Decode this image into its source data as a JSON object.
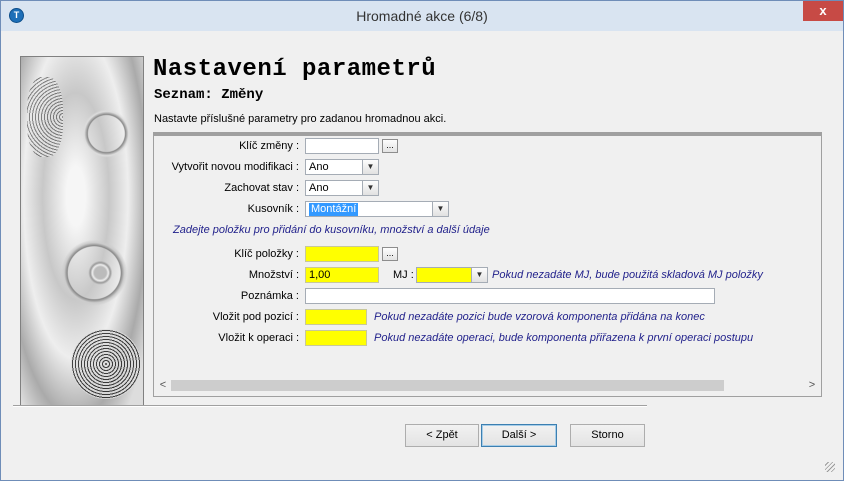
{
  "window": {
    "title": "Hromadné akce (6/8)",
    "close_glyph": "x",
    "app_icon_glyph": "T"
  },
  "header": {
    "title": "Nastavení parametrů",
    "subtitle": "Seznam: Změny",
    "description": "Nastavte příslušné parametry pro zadanou hromadnou akci."
  },
  "form": {
    "klic_zmeny": {
      "label": "Klíč změny :",
      "value": "",
      "browse_label": "..."
    },
    "vytvorit_modifikaci": {
      "label": "Vytvořit novou modifikaci :",
      "value": "Ano"
    },
    "zachovat_stav": {
      "label": "Zachovat stav :",
      "value": "Ano"
    },
    "kusovnik": {
      "label": "Kusovník :",
      "value": "Montážní"
    },
    "section_hint": "Zadejte položku pro přidání do kusovníku, množství a další údaje",
    "klic_polozky": {
      "label": "Klíč položky :",
      "value": "",
      "browse_label": "..."
    },
    "mnozstvi": {
      "label": "Množství :",
      "value": "1,00"
    },
    "mj": {
      "label": "MJ :",
      "value": "",
      "hint": "Pokud nezadáte MJ, bude použitá skladová MJ položky"
    },
    "poznamka": {
      "label": "Poznámka :",
      "value": ""
    },
    "vlozit_pod_pozici": {
      "label": "Vložit pod pozicí :",
      "value": "",
      "hint": "Pokud nezadáte pozici bude vzorová komponenta přidána na konec"
    },
    "vlozit_k_operaci": {
      "label": "Vložit k operaci :",
      "value": "",
      "hint": "Pokud nezadáte operaci, bude komponenta přiřazena k první operaci postupu"
    }
  },
  "buttons": {
    "back": "< Zpět",
    "next": "Další >",
    "cancel": "Storno"
  },
  "scrollbar": {
    "left_glyph": "<",
    "right_glyph": ">"
  },
  "combo_arrow_glyph": "▼",
  "colors": {
    "highlight": "#ffff00",
    "hint_text": "#1f1f8a",
    "selection": "#3399ff"
  }
}
